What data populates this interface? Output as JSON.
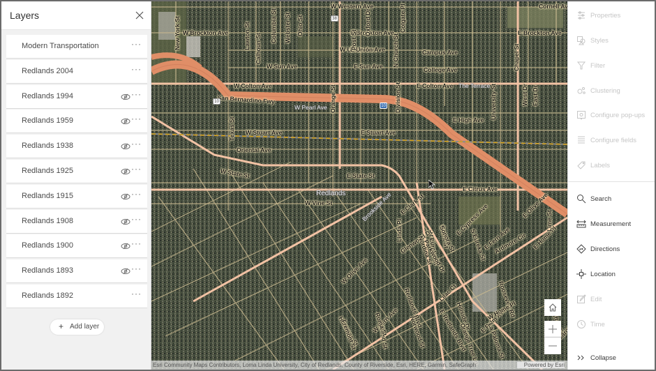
{
  "layers_panel": {
    "title": "Layers",
    "close_icon": "close-icon",
    "items": [
      {
        "label": "Modern Transportation",
        "visibility_icon": false
      },
      {
        "label": "Redlands 2004",
        "visibility_icon": false
      },
      {
        "label": "Redlands 1994",
        "visibility_icon": true
      },
      {
        "label": "Redlands 1959",
        "visibility_icon": true
      },
      {
        "label": "Redlands 1938",
        "visibility_icon": true
      },
      {
        "label": "Redlands 1925",
        "visibility_icon": true
      },
      {
        "label": "Redlands 1915",
        "visibility_icon": true
      },
      {
        "label": "Redlands 1908",
        "visibility_icon": true
      },
      {
        "label": "Redlands 1900",
        "visibility_icon": true
      },
      {
        "label": "Redlands 1893",
        "visibility_icon": true
      },
      {
        "label": "Redlands 1892",
        "visibility_icon": false
      }
    ],
    "more_label": "···",
    "add_layer": {
      "icon": "+",
      "label": "Add layer"
    }
  },
  "map": {
    "place_label": "Redlands",
    "shields": [
      {
        "type": "us",
        "label": "38"
      },
      {
        "type": "us",
        "label": "10"
      },
      {
        "type": "interstate",
        "label": "10"
      }
    ],
    "street_labels": [
      "W Western Ave",
      "W Brockton Ave",
      "E Brockton Ave",
      "E Brockton Ave",
      "W Union Ave",
      "E Union Ave",
      "Campus Ave",
      "W Sun Ave",
      "E Sun Ave",
      "College Ave",
      "W Colton Ave",
      "E Colton Ave",
      "The Terrace",
      "San Bernardino Fwy",
      "W Pearl Ave",
      "E High Ave",
      "W Stuart Ave",
      "E Stuart Ave",
      "Oriental Ave",
      "W State St",
      "E State St",
      "E Citrus Ave",
      "W Vine St",
      "Cornell Ave",
      "New York St",
      "Lawton St",
      "Calhoun St",
      "Columbia St",
      "Webster St",
      "Ohio St",
      "Orange St",
      "Post St",
      "Oxford Dr",
      "N Church St",
      "Colgate Pl",
      "Chapel St",
      "Division St",
      "West Dr",
      "East Dr",
      "University St",
      "Texas St",
      "N Eureka St",
      "Brookside Ave",
      "Linda Pl",
      "Glenwood Dr",
      "Parkwood Dr",
      "Grant St",
      "S Eureka St",
      "E Olive Ave",
      "E Clark St",
      "Nordina St",
      "Sonora St",
      "E Fern Ave",
      "E Home Pl",
      "Lime St",
      "E Cypress Ave",
      "Ardmore Cir",
      "W Olive Ave",
      "W Fern Ave",
      "Norwood St",
      "Bond St",
      "Hastings St",
      "Fremont St",
      "Roma St",
      "Clifton St",
      "Lilac Ct",
      "Hillside Dr",
      "E Palm Ave",
      "La Paloma St",
      "E Redlands Blvd",
      "Orange Tree Ln",
      "Redlands Blvd",
      "Roosevelt Rd",
      "Carol Dr",
      "W Home Pl"
    ],
    "controls": {
      "home_icon": "home-icon",
      "zoom_in": "+",
      "zoom_out": "−"
    },
    "attribution": "Esri Community Maps Contributors, Loma Linda University, City of Redlands, County of Riverside, Esri, HERE, Garmin, SafeGraph",
    "powered_by": "Powered by Esri"
  },
  "toolbar": {
    "items": [
      {
        "label": "Properties",
        "icon": "sliders-icon",
        "enabled": false
      },
      {
        "label": "Styles",
        "icon": "styles-icon",
        "enabled": false
      },
      {
        "label": "Filter",
        "icon": "filter-icon",
        "enabled": false
      },
      {
        "label": "Clustering",
        "icon": "clustering-icon",
        "enabled": false
      },
      {
        "label": "Configure pop-ups",
        "icon": "popup-icon",
        "enabled": false
      },
      {
        "label": "Configure fields",
        "icon": "fields-icon",
        "enabled": false
      },
      {
        "label": "Labels",
        "icon": "labels-icon",
        "enabled": false
      },
      {
        "label": "Search",
        "icon": "search-icon",
        "enabled": true
      },
      {
        "label": "Measurement",
        "icon": "measurement-icon",
        "enabled": true
      },
      {
        "label": "Directions",
        "icon": "directions-icon",
        "enabled": true
      },
      {
        "label": "Location",
        "icon": "location-icon",
        "enabled": true
      },
      {
        "label": "Edit",
        "icon": "edit-icon",
        "enabled": false
      },
      {
        "label": "Time",
        "icon": "time-icon",
        "enabled": false
      },
      {
        "label": "Collapse",
        "icon": "collapse-icon",
        "enabled": true
      }
    ]
  }
}
